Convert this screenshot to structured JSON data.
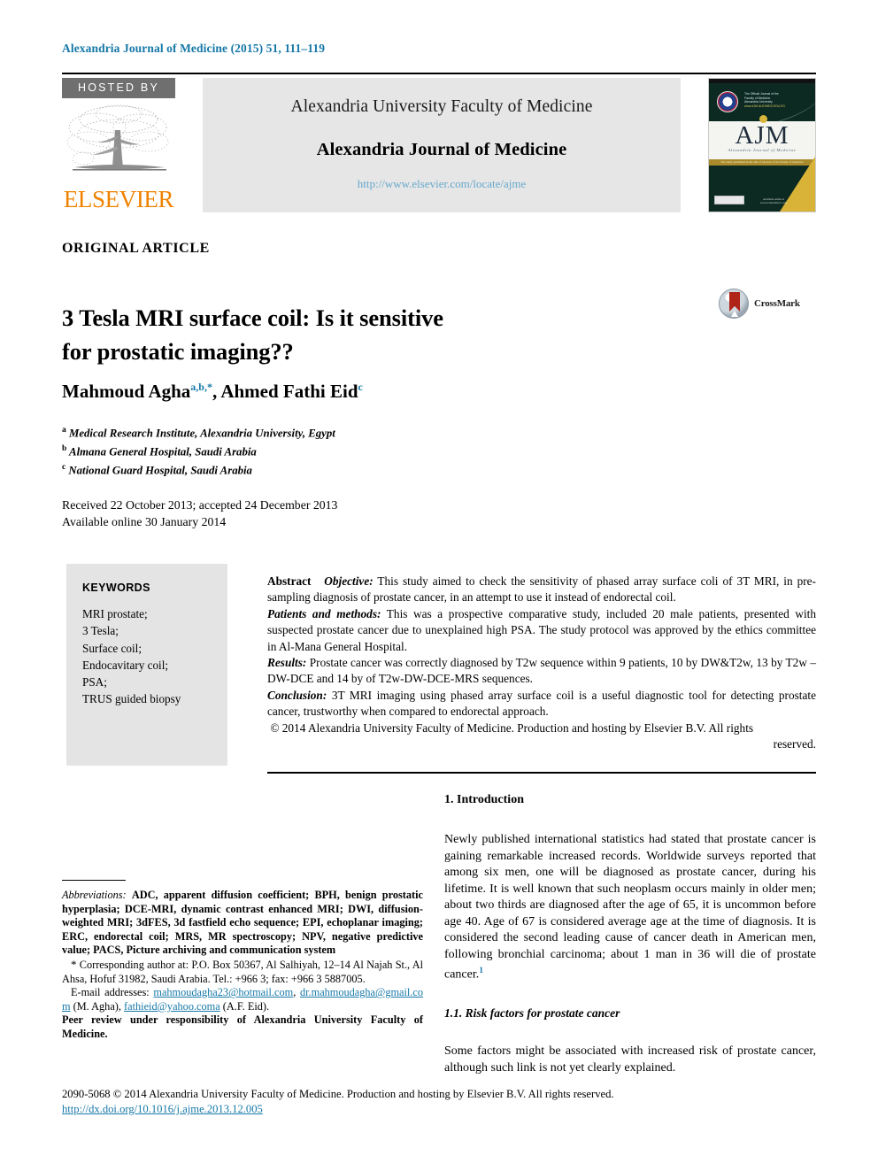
{
  "running_head": {
    "journal": "Alexandria Journal of Medicine (2015)",
    "volume": "51",
    "pages": ", 111–119"
  },
  "masthead": {
    "hosted_by_label": "HOSTED BY",
    "publisher_logo_text": "ELSEVIER",
    "publisher_name": "Alexandria University Faculty of Medicine",
    "journal_name": "Alexandria Journal of Medicine",
    "journal_url": "http://www.elsevier.com/locate/ajme",
    "cover": {
      "acronym": "AJM",
      "acronym_sub": "Alexandria Journal of Medicine",
      "seal_text_line1": "The Official Journal of the",
      "seal_text_line2": "Faculty of Medicine",
      "seal_text_line3": "Alexandria University",
      "seal_text_line4": "www.AJM.ALEXMED.EDU.EG",
      "gold_band_text": "The study published in the aim of advance of the faculty of medicine",
      "foot_text": "Available online at www.sciencedirect.com"
    }
  },
  "article": {
    "type": "ORIGINAL ARTICLE",
    "title_line1": "3 Tesla MRI surface coil: Is it sensitive",
    "title_line2": "for prostatic imaging??",
    "crossmark_label": "CrossMark",
    "authors": [
      {
        "name": "Mahmoud Agha",
        "marks": "a,b,*"
      },
      {
        "name": "Ahmed Fathi Eid",
        "marks": "c"
      }
    ],
    "authors_separator": ", ",
    "affiliations": [
      {
        "mark": "a",
        "text": "Medical Research Institute, Alexandria University, Egypt"
      },
      {
        "mark": "b",
        "text": "Almana General Hospital, Saudi Arabia"
      },
      {
        "mark": "c",
        "text": "National Guard Hospital, Saudi Arabia"
      }
    ],
    "dates_line1": "Received 22 October 2013; accepted 24 December 2013",
    "dates_line2": "Available online 30 January 2014"
  },
  "keywords": {
    "heading": "KEYWORDS",
    "items": [
      "MRI prostate;",
      "3 Tesla;",
      "Surface coil;",
      "Endocavitary coil;",
      "PSA;",
      "TRUS guided biopsy"
    ]
  },
  "abstract": {
    "label": "Abstract",
    "objective_label": "Objective:",
    "objective_text": "This study aimed to check the sensitivity of phased array surface coli of 3T MRI, in pre-sampling diagnosis of prostate cancer, in an attempt to use it instead of endorectal coil.",
    "patients_label": "Patients and methods:",
    "patients_text": "This was a prospective comparative study, included 20 male patients, presented with suspected prostate cancer due to unexplained high PSA. The study protocol was approved by the ethics committee in Al-Mana General Hospital.",
    "results_label": "Results:",
    "results_text": "Prostate cancer was correctly diagnosed by T2w sequence within 9 patients, 10 by DW&T2w, 13 by T2w – DW-DCE and 14 by of T2w-DW-DCE-MRS sequences.",
    "conclusion_label": "Conclusion:",
    "conclusion_text": "3T MRI imaging using phased array surface coil is a useful diagnostic tool for detecting prostate cancer, trustworthy when compared to endorectal approach.",
    "copyright": "© 2014 Alexandria University Faculty of Medicine. Production and hosting by Elsevier B.V. All rights",
    "copyright_tail": "reserved."
  },
  "body": {
    "section1_heading": "1. Introduction",
    "section1_paragraph": "Newly published international statistics had stated that prostate cancer is gaining remarkable increased records. Worldwide surveys reported that among six men, one will be diagnosed as prostate cancer, during his lifetime. It is well known that such neoplasm occurs mainly in older men; about two thirds are diagnosed after the age of 65, it is uncommon before age 40. Age of 67 is considered average age at the time of diagnosis. It is considered the second leading cause of cancer death in American men, following bronchial carcinoma; about 1 man in 36 will die of prostate cancer.",
    "section1_paragraph_ref": "1",
    "subsection_heading": "1.1. Risk factors for prostate cancer",
    "subsection_paragraph": "Some factors might be associated with increased risk of prostate cancer, although such link is not yet clearly explained."
  },
  "footnotes": {
    "abbreviations_label": "Abbreviations:",
    "abbreviations_text": "ADC, apparent diffusion coefficient; BPH, benign prostatic hyperplasia; DCE-MRI, dynamic contrast enhanced MRI; DWI, diffusion-weighted MRI; 3dFES, 3d fastfield echo sequence; EPI, echoplanar imaging; ERC, endorectal coil; MRS, MR spectroscopy; NPV, negative predictive value; PACS, Picture archiving and communication system",
    "corresponding_marker": "*",
    "corresponding_text": "Corresponding author at: P.O. Box 50367, Al Salhiyah, 12–14 Al Najah St., Al Ahsa, Hofuf 31982, Saudi Arabia. Tel.: +966 3; fax: +966 3 5887005.",
    "email_label": "E-mail addresses:",
    "emails": [
      {
        "address": "mahmoudagha23@hotmail.com",
        "owner": ""
      },
      {
        "address": "dr.mahmoudagha@gmail.com",
        "owner": "(M. Agha)"
      },
      {
        "address": "fathieid@yahoo.coma",
        "owner": "(A.F. Eid)"
      }
    ],
    "peer_review": "Peer review under responsibility of Alexandria University Faculty of Medicine."
  },
  "bottom": {
    "issn_line": "2090-5068 © 2014 Alexandria University Faculty of Medicine. Production and hosting by Elsevier B.V. All rights reserved.",
    "doi": "http://dx.doi.org/10.1016/j.ajme.2013.12.005"
  }
}
